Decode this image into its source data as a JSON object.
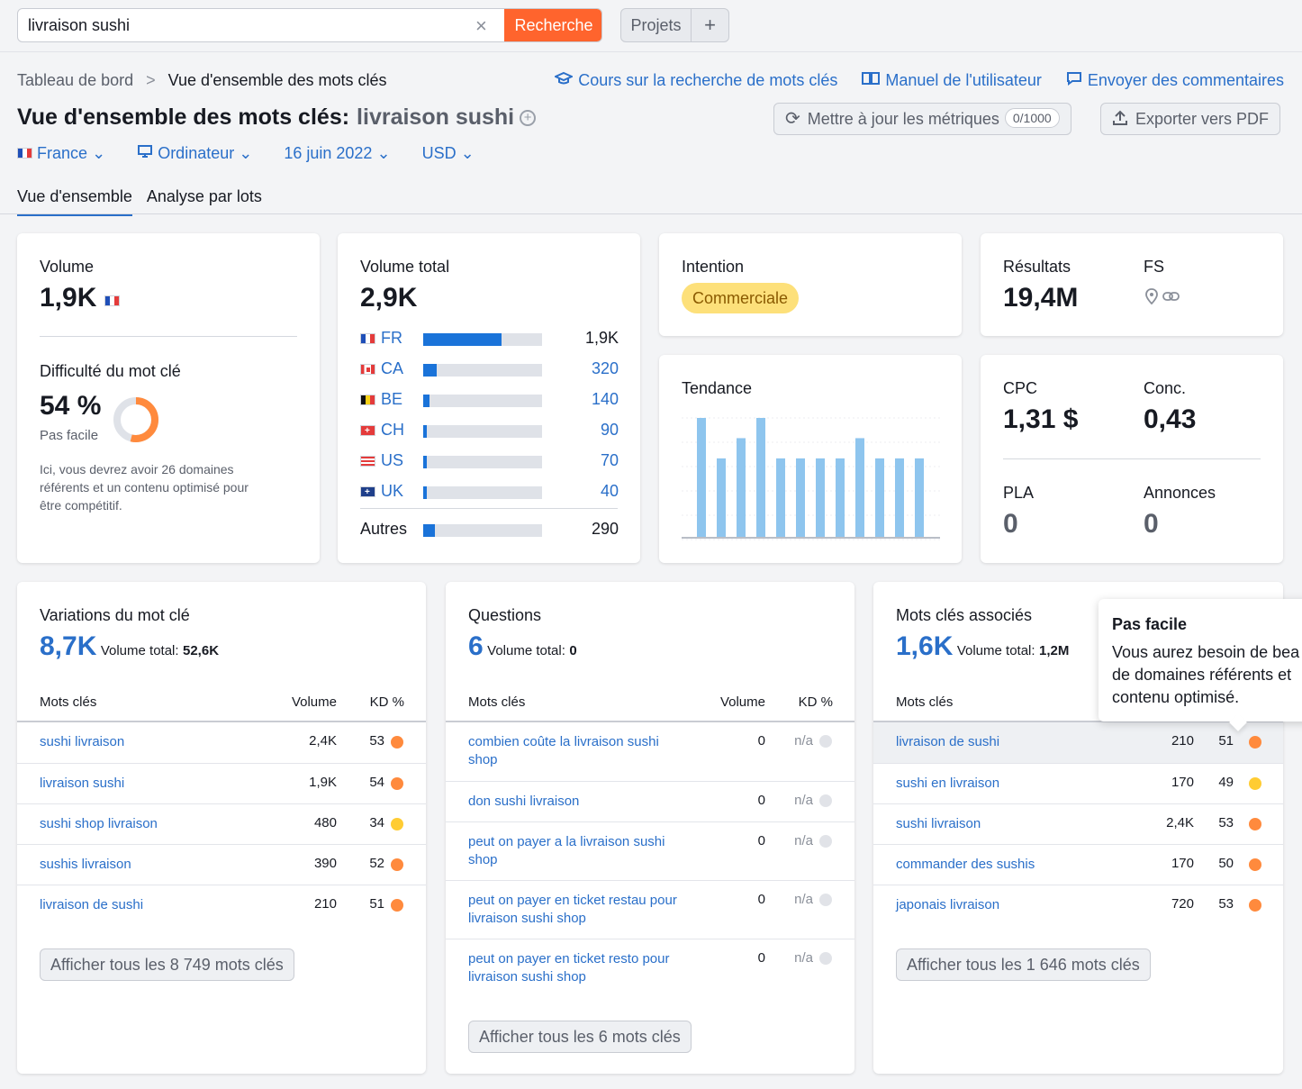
{
  "search": {
    "value": "livraison sushi",
    "button": "Recherche",
    "clear": "×"
  },
  "projects": {
    "label": "Projets",
    "add": "+"
  },
  "breadcrumb": {
    "root": "Tableau de bord",
    "sep": ">",
    "current": "Vue d'ensemble des mots clés"
  },
  "header_links": {
    "course": "Cours sur la recherche de mots clés",
    "manual": "Manuel de l'utilisateur",
    "feedback": "Envoyer des commentaires"
  },
  "title": {
    "prefix": "Vue d'ensemble des mots clés:",
    "keyword": "livraison sushi",
    "add": "+"
  },
  "actions": {
    "update": "Mettre à jour les métriques",
    "update_badge": "0/1000",
    "export": "Exporter vers PDF"
  },
  "filters": {
    "country": "France",
    "device": "Ordinateur",
    "date": "16 juin 2022",
    "currency": "USD"
  },
  "tabs": [
    "Vue d'ensemble",
    "Analyse par lots"
  ],
  "volume": {
    "label": "Volume",
    "value": "1,9K"
  },
  "difficulty": {
    "label": "Difficulté du mot clé",
    "value": "54 %",
    "percent": 54,
    "level": "Pas facile",
    "desc1": "Ici, vous devrez avoir 26 domaines",
    "desc2": "référents et un contenu optimisé pour",
    "desc3": "être compétitif."
  },
  "total_volume": {
    "label": "Volume total",
    "value": "2,9K",
    "rows": [
      {
        "cc": "FR",
        "value": "1,9K",
        "fill": 0.66
      },
      {
        "cc": "CA",
        "value": "320",
        "fill": 0.11
      },
      {
        "cc": "BE",
        "value": "140",
        "fill": 0.05
      },
      {
        "cc": "CH",
        "value": "90",
        "fill": 0.03
      },
      {
        "cc": "US",
        "value": "70",
        "fill": 0.025
      },
      {
        "cc": "UK",
        "value": "40",
        "fill": 0.015
      }
    ],
    "others": {
      "label": "Autres",
      "value": "290",
      "fill": 0.1
    }
  },
  "intent": {
    "label": "Intention",
    "value": "Commerciale"
  },
  "results": {
    "label": "Résultats",
    "value": "19,4M",
    "fs_label": "FS"
  },
  "trend": {
    "label": "Tendance",
    "values": [
      1.0,
      0.66,
      0.83,
      1.0,
      0.66,
      0.66,
      0.66,
      0.66,
      0.83,
      0.66,
      0.66,
      0.66
    ]
  },
  "cpc": {
    "label": "CPC",
    "value": "1,31 $",
    "conc_label": "Conc.",
    "conc_value": "0,43",
    "pla_label": "PLA",
    "pla_value": "0",
    "ads_label": "Annonces",
    "ads_value": "0"
  },
  "variations": {
    "title": "Variations du mot clé",
    "count": "8,7K",
    "total_label": "Volume total:",
    "total_value": "52,6K",
    "col_kw": "Mots clés",
    "col_vol": "Volume",
    "col_kd": "KD %",
    "rows": [
      {
        "kw": "sushi livraison",
        "vol": "2,4K",
        "kd": "53",
        "c": "orange"
      },
      {
        "kw": "livraison sushi",
        "vol": "1,9K",
        "kd": "54",
        "c": "orange"
      },
      {
        "kw": "sushi shop livraison",
        "vol": "480",
        "kd": "34",
        "c": "yellow"
      },
      {
        "kw": "sushis livraison",
        "vol": "390",
        "kd": "52",
        "c": "orange"
      },
      {
        "kw": "livraison de sushi",
        "vol": "210",
        "kd": "51",
        "c": "orange"
      }
    ],
    "button": "Afficher tous les 8 749 mots clés"
  },
  "questions": {
    "title": "Questions",
    "count": "6",
    "total_label": "Volume total:",
    "total_value": "0",
    "col_kw": "Mots clés",
    "col_vol": "Volume",
    "col_kd": "KD %",
    "rows": [
      {
        "kw1": "combien coûte la livraison sushi",
        "kw2": "shop",
        "vol": "0",
        "kd": "n/a"
      },
      {
        "kw1": "don sushi livraison",
        "kw2": "",
        "vol": "0",
        "kd": "n/a"
      },
      {
        "kw1": "peut on payer a la livraison sushi",
        "kw2": "shop",
        "vol": "0",
        "kd": "n/a"
      },
      {
        "kw1": "peut on payer en ticket restau pour",
        "kw2": "livraison sushi shop",
        "vol": "0",
        "kd": "n/a"
      },
      {
        "kw1": "peut on payer en ticket resto pour",
        "kw2": "livraison sushi shop",
        "vol": "0",
        "kd": "n/a"
      }
    ],
    "button": "Afficher tous les 6 mots clés"
  },
  "related": {
    "title": "Mots clés associés",
    "count": "1,6K",
    "total_label": "Volume total:",
    "total_value": "1,2M",
    "col_kw": "Mots clés",
    "rows": [
      {
        "kw": "livraison de sushi",
        "vol": "210",
        "kd": "51",
        "c": "orange"
      },
      {
        "kw": "sushi en livraison",
        "vol": "170",
        "kd": "49",
        "c": "yellow"
      },
      {
        "kw": "sushi livraison",
        "vol": "2,4K",
        "kd": "53",
        "c": "orange"
      },
      {
        "kw": "commander des sushis",
        "vol": "170",
        "kd": "50",
        "c": "orange"
      },
      {
        "kw": "japonais livraison",
        "vol": "720",
        "kd": "53",
        "c": "orange"
      }
    ],
    "button": "Afficher tous les 1 646 mots clés"
  },
  "tooltip": {
    "title": "Pas facile",
    "line1": "Vous aurez besoin de bea",
    "line2": "de domaines référents et",
    "line3": "contenu optimisé."
  },
  "colors": {
    "accent": "#ff642d",
    "link": "#2a6fc9",
    "bar": "#1a73d9",
    "trend": "#8ec5ee",
    "kd_orange": "#ff8a3d",
    "kd_yellow": "#ffcc33",
    "intent": "#fde07a"
  }
}
